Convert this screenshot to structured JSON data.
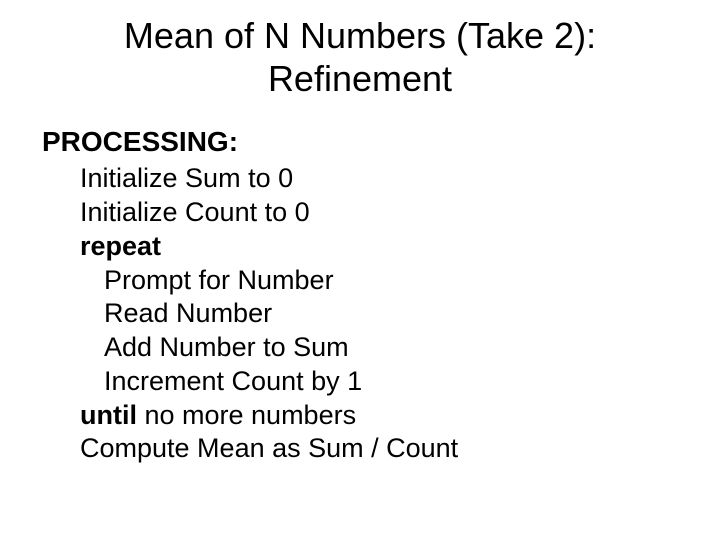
{
  "title": {
    "line1": "Mean of N Numbers (Take 2):",
    "line2": "Refinement"
  },
  "section_heading": "PROCESSING:",
  "lines": {
    "l1": "Initialize Sum to 0",
    "l2": "Initialize Count to 0",
    "l3_bold": "repeat",
    "l4": "Prompt for Number",
    "l5": "Read Number",
    "l6": "Add Number to Sum",
    "l7": "Increment Count by 1",
    "l8_bold": "until",
    "l8_rest": " no more numbers",
    "l9": "Compute Mean as Sum / Count"
  }
}
